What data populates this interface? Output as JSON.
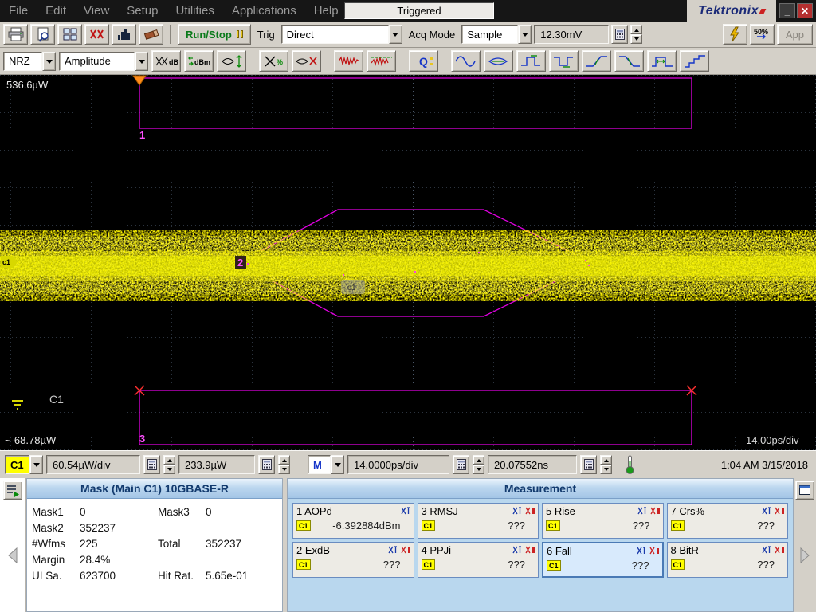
{
  "titlebar": {
    "menus": [
      "File",
      "Edit",
      "View",
      "Setup",
      "Utilities",
      "Applications",
      "Help"
    ],
    "trigger_status": "Triggered",
    "brand": "Tektronix",
    "minimize": "_",
    "close": "✕"
  },
  "toolbar": {
    "run_stop_label": "Run/Stop",
    "trig_label": "Trig",
    "trig_source": "Direct",
    "acq_mode_label": "Acq Mode",
    "acq_mode": "Sample",
    "trigger_level": "12.30mV",
    "autoset_pct": "50%",
    "app_button": "App"
  },
  "measure_toolbar": {
    "signal_format": "NRZ",
    "category": "Amplitude"
  },
  "icons": {
    "toolbar": [
      "printer-icon",
      "print-preview-icon",
      "tile-windows-icon",
      "mask-test-icon",
      "histogram-icon",
      "clear-data-icon",
      "autoset-icon",
      "set-50pct-icon"
    ],
    "measure_toolbar": [
      "extinction-ratio-icon",
      "avg-power-dbm-icon",
      "amplitude-icon",
      "crossing-percent-icon",
      "eye-mask-hits-icon",
      "jitter-pp-icon",
      "jitter-rms-icon",
      "q-factor-icon",
      "period-icon",
      "eye-width-icon",
      "high-level-icon",
      "low-level-icon",
      "rise-time-icon",
      "fall-time-icon",
      "pulse-width-icon",
      "stairstep-icon"
    ]
  },
  "display": {
    "top_scale": "536.6µW",
    "bottom_scale": "~-68.78µW",
    "channel_label": "C1",
    "timebase_label": "14.00ps/div",
    "marker1": "1",
    "marker2": "2",
    "marker3": "3",
    "left_marker": "c1",
    "handle_label": "c1",
    "colors": {
      "mask": "#e400e4",
      "trace": "#ffff00",
      "trigger": "#ff8c1a"
    }
  },
  "statusbar": {
    "channel": "C1",
    "vertical_scale": "60.54µW/div",
    "vertical_offset": "233.9µW",
    "horizontal_source": "M",
    "horizontal_scale": "14.0000ps/div",
    "horizontal_position": "20.07552ns",
    "datetime": "1:04 AM 3/15/2018"
  },
  "mask_panel": {
    "title": "Mask (Main  C1) 10GBASE-R",
    "stats": [
      {
        "label": "Mask1",
        "value": "0"
      },
      {
        "label": "Mask3",
        "value": "0"
      },
      {
        "label": "Mask2",
        "value": "352237"
      },
      {
        "label": "#Wfms",
        "value": "225"
      },
      {
        "label": "Total",
        "value": "352237"
      },
      {
        "label": "Margin",
        "value": "28.4%"
      },
      {
        "label": "UI Sa.",
        "value": "623700"
      },
      {
        "label": "Hit Rat.",
        "value": "5.65e-01"
      }
    ]
  },
  "measurement_panel": {
    "title": "Measurement",
    "tiles": [
      {
        "label": "1 AOPd",
        "source": "C1",
        "value": "-6.392884dBm"
      },
      {
        "label": "3 RMSJ",
        "source": "C1",
        "value": "???"
      },
      {
        "label": "5 Rise",
        "source": "C1",
        "value": "???"
      },
      {
        "label": "7 Crs%",
        "source": "C1",
        "value": "???"
      },
      {
        "label": "2 ExdB",
        "source": "C1",
        "value": "???"
      },
      {
        "label": "4 PPJi",
        "source": "C1",
        "value": "???"
      },
      {
        "label": "6 Fall",
        "source": "C1",
        "value": "???"
      },
      {
        "label": "8 BitR",
        "source": "C1",
        "value": "???"
      }
    ]
  }
}
